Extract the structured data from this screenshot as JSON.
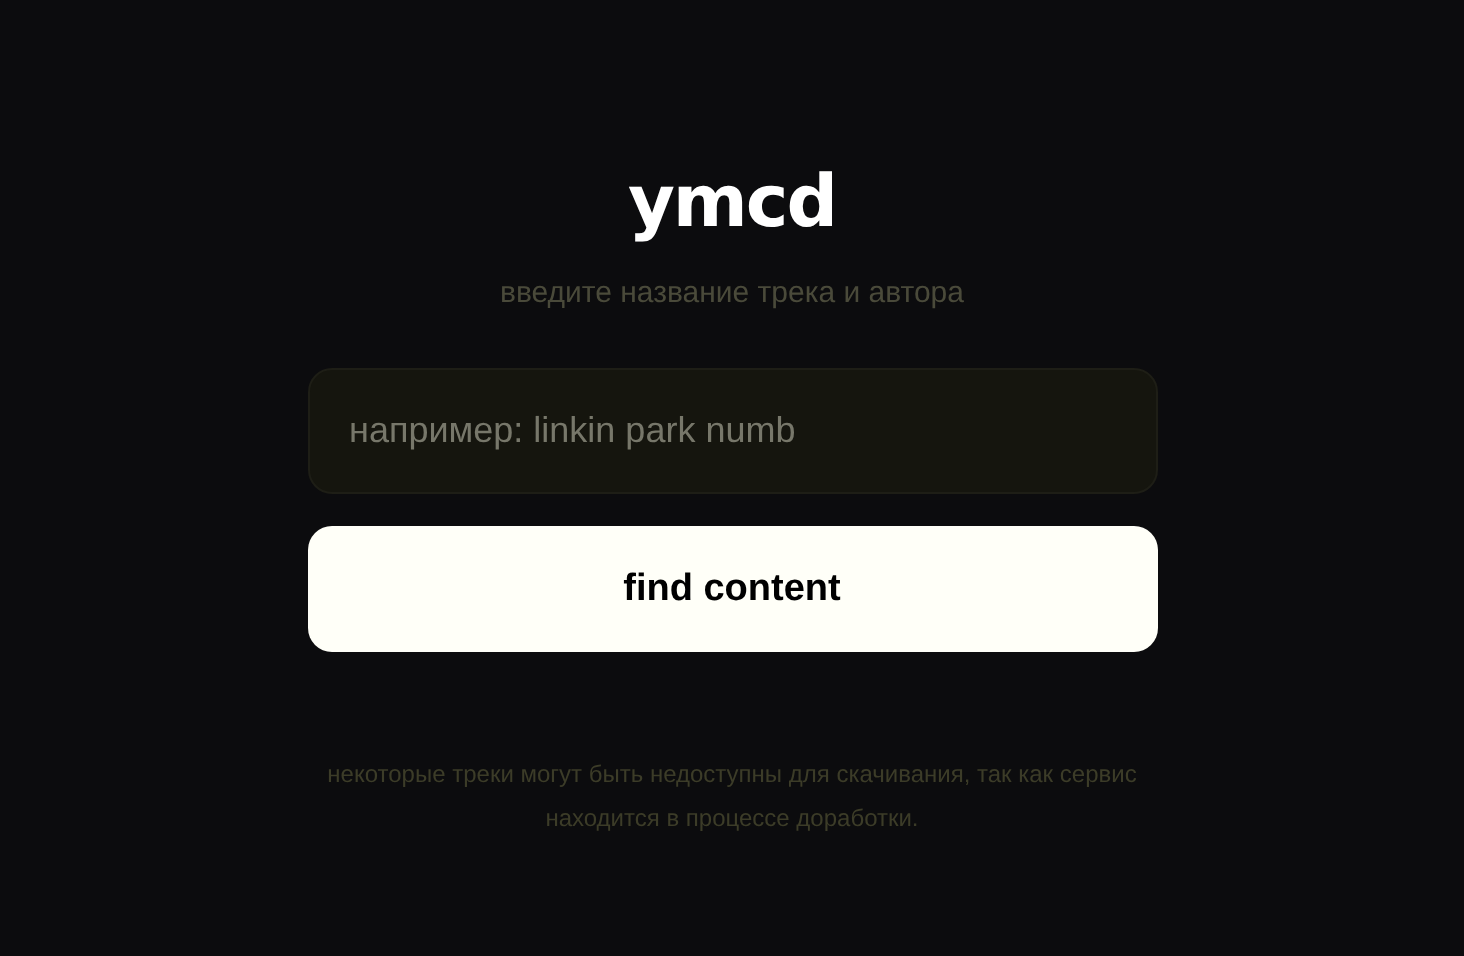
{
  "title": "ymcd",
  "subtitle": "введите название трека и автора",
  "search": {
    "placeholder": "например: linkin park numb"
  },
  "button": "find content",
  "footer": "некоторые треки могут быть недоступны для скачивания, так как сервис находится в процессе доработки."
}
